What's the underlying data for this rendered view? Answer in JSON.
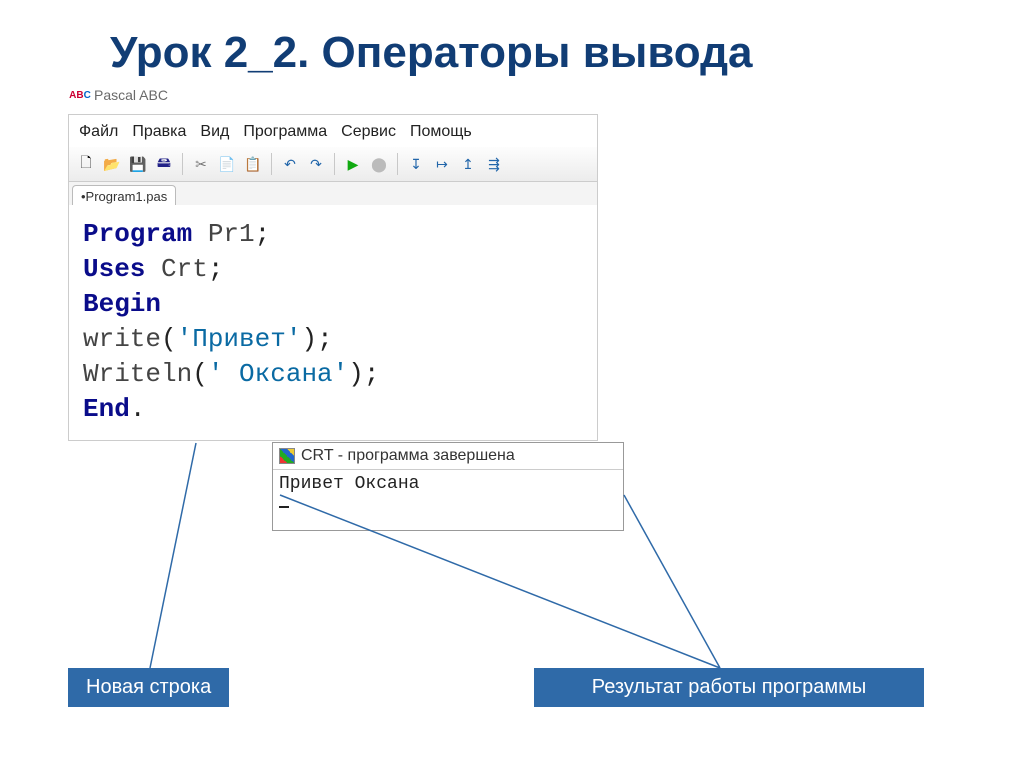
{
  "slide_title": "Урок 2_2. Операторы вывода",
  "ide": {
    "app_title": "Pascal ABC",
    "menu": [
      "Файл",
      "Правка",
      "Вид",
      "Программа",
      "Сервис",
      "Помощь"
    ],
    "tab": "•Program1.pas",
    "icons": {
      "new": "🗋",
      "open": "📂",
      "save": "💾",
      "save_all": "🖴",
      "cut": "✂",
      "copy": "📄",
      "paste": "📋",
      "undo": "↶",
      "redo": "↷",
      "run": "▶",
      "stop": "⬤",
      "step_in": "↧",
      "step_over": "↦",
      "step_out": "↥",
      "trace": "⇶"
    },
    "code": {
      "l1_kw": "Program",
      "l1_id": "Pr1",
      "semi": ";",
      "l2_kw": "Uses",
      "l2_id": "Crt",
      "l3_kw": "Begin",
      "l4_fn": "write",
      "l4_str": "'Привет'",
      "l5_fn": "Writeln",
      "l5_str": "' Оксана'",
      "l6_kw": "End",
      "dot": ".",
      "paren_o": "(",
      "paren_c": ")"
    }
  },
  "crt": {
    "title": "CRT - программа завершена",
    "output": "Привет Оксана"
  },
  "callouts": {
    "left": "Новая строка",
    "right": "Результат работы программы"
  }
}
